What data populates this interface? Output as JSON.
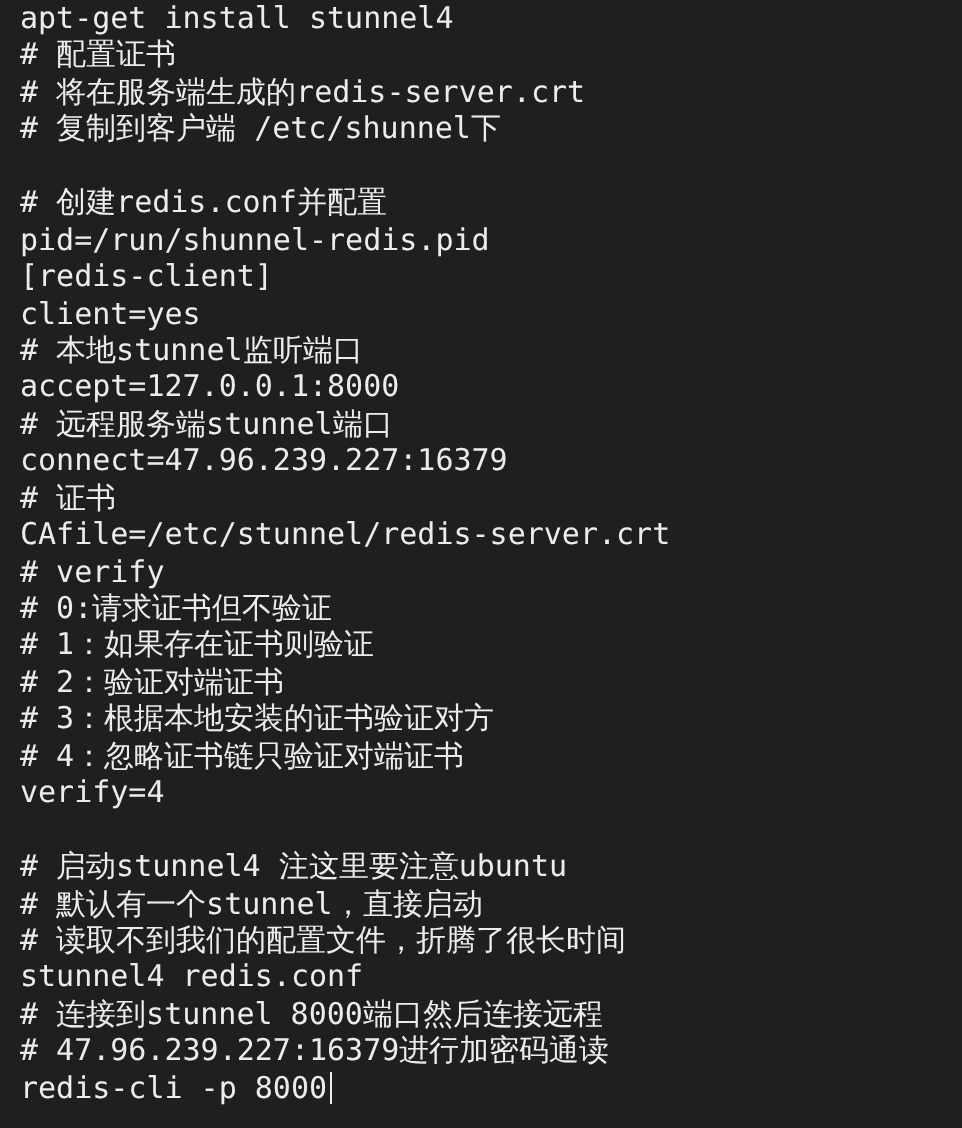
{
  "terminal": {
    "lines": [
      {
        "kind": "text",
        "text": "apt-get install stunnel4"
      },
      {
        "kind": "text",
        "text": "# 配置证书"
      },
      {
        "kind": "text",
        "text": "# 将在服务端生成的redis-server.crt"
      },
      {
        "kind": "text",
        "text": "# 复制到客户端 /etc/shunnel下"
      },
      {
        "kind": "blank"
      },
      {
        "kind": "text",
        "text": "# 创建redis.conf并配置"
      },
      {
        "kind": "text",
        "text": "pid=/run/shunnel-redis.pid"
      },
      {
        "kind": "text",
        "text": "[redis-client]"
      },
      {
        "kind": "text",
        "text": "client=yes"
      },
      {
        "kind": "text",
        "text": "# 本地stunnel监听端口"
      },
      {
        "kind": "text",
        "text": "accept=127.0.0.1:8000"
      },
      {
        "kind": "text",
        "text": "# 远程服务端stunnel端口"
      },
      {
        "kind": "text",
        "text": "connect=47.96.239.227:16379"
      },
      {
        "kind": "text",
        "text": "# 证书"
      },
      {
        "kind": "text",
        "text": "CAfile=/etc/stunnel/redis-server.crt"
      },
      {
        "kind": "text",
        "text": "# verify"
      },
      {
        "kind": "text",
        "text": "# 0:请求证书但不验证"
      },
      {
        "kind": "text",
        "text": "# 1：如果存在证书则验证"
      },
      {
        "kind": "text",
        "text": "# 2：验证对端证书"
      },
      {
        "kind": "text",
        "text": "# 3：根据本地安装的证书验证对方"
      },
      {
        "kind": "text",
        "text": "# 4：忽略证书链只验证对端证书"
      },
      {
        "kind": "text",
        "text": "verify=4"
      },
      {
        "kind": "blank"
      },
      {
        "kind": "text",
        "text": "# 启动stunnel4 注这里要注意ubuntu"
      },
      {
        "kind": "text",
        "text": "# 默认有一个stunnel，直接启动"
      },
      {
        "kind": "text",
        "text": "# 读取不到我们的配置文件，折腾了很长时间"
      },
      {
        "kind": "text",
        "text": "stunnel4 redis.conf"
      },
      {
        "kind": "text",
        "text": "# 连接到stunnel 8000端口然后连接远程"
      },
      {
        "kind": "text",
        "text": "# 47.96.239.227:16379进行加密码通读"
      },
      {
        "kind": "text",
        "text": "redis-cli -p 8000",
        "cursor": true
      }
    ]
  }
}
